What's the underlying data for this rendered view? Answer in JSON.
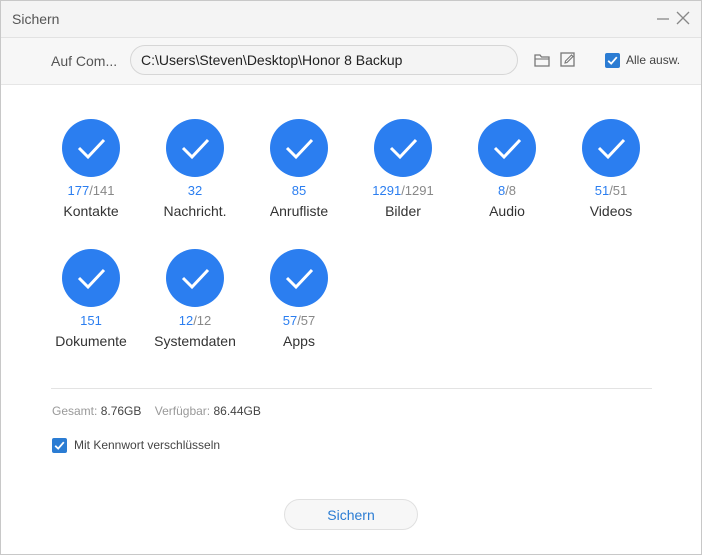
{
  "window": {
    "title": "Sichern"
  },
  "path_bar": {
    "label": "Auf Com...",
    "path_value": "C:\\Users\\Steven\\Desktop\\Honor 8 Backup",
    "select_all_label": "Alle ausw.",
    "select_all_checked": true
  },
  "categories": [
    {
      "label": "Kontakte",
      "selected": "177",
      "total": "/141"
    },
    {
      "label": "Nachricht.",
      "selected": "32",
      "total": ""
    },
    {
      "label": "Anrufliste",
      "selected": "85",
      "total": ""
    },
    {
      "label": "Bilder",
      "selected": "1291",
      "total": "/1291"
    },
    {
      "label": "Audio",
      "selected": "8",
      "total": "/8"
    },
    {
      "label": "Videos",
      "selected": "51",
      "total": "/51"
    },
    {
      "label": "Dokumente",
      "selected": "151",
      "total": ""
    },
    {
      "label": "Systemdaten",
      "selected": "12",
      "total": "/12"
    },
    {
      "label": "Apps",
      "selected": "57",
      "total": "/57"
    }
  ],
  "storage": {
    "total_label": "Gesamt:",
    "total_value": "8.76GB",
    "available_label": "Verfügbar:",
    "available_value": "86.44GB"
  },
  "encrypt": {
    "label": "Mit Kennwort verschlüsseln",
    "checked": true
  },
  "save_button_label": "Sichern",
  "colors": {
    "accent": "#2b7ef0",
    "checkbox": "#2b7cd3",
    "muted": "#888888"
  },
  "icons": {
    "minimize": "minimize-icon",
    "close": "close-icon",
    "folder": "folder-icon",
    "edit": "edit-icon",
    "check": "checkmark-icon"
  }
}
